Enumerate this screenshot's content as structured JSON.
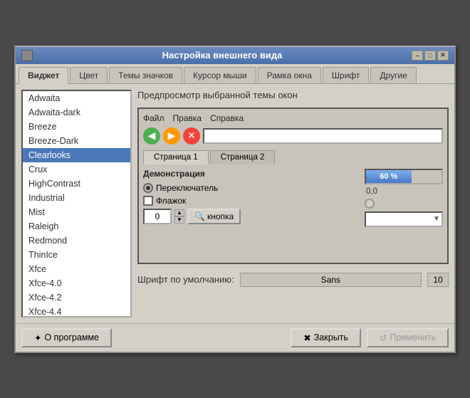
{
  "window": {
    "title": "Настройка внешнего вида",
    "icon": "settings-icon"
  },
  "titlebar": {
    "controls": {
      "minimize": "–",
      "maximize": "□",
      "close": "✕"
    }
  },
  "tabs": {
    "items": [
      {
        "label": "Виджет",
        "active": true
      },
      {
        "label": "Цвет",
        "active": false
      },
      {
        "label": "Темы значков",
        "active": false
      },
      {
        "label": "Курсор мыши",
        "active": false
      },
      {
        "label": "Рамка окна",
        "active": false
      },
      {
        "label": "Шрифт",
        "active": false
      },
      {
        "label": "Другие",
        "active": false
      }
    ]
  },
  "theme_list": {
    "items": [
      "Adwaita",
      "Adwaita-dark",
      "Breeze",
      "Breeze-Dark",
      "Clearlooks",
      "Crux",
      "HighContrast",
      "Industrial",
      "Mist",
      "Raleigh",
      "Redmond",
      "ThinIce",
      "Xfce",
      "Xfce-4.0",
      "Xfce-4.2",
      "Xfce-4.4"
    ],
    "selected": "Clearlooks"
  },
  "preview": {
    "section_label": "Предпросмотр выбранной темы окон",
    "menubar": {
      "items": [
        "Файл",
        "Правка",
        "Справка"
      ]
    },
    "toolbar": {
      "back": "◀",
      "forward": "▶",
      "stop": "✕"
    },
    "tabs": {
      "items": [
        {
          "label": "Страница 1",
          "active": true
        },
        {
          "label": "Страница 2",
          "active": false
        }
      ]
    },
    "demo": {
      "title": "Демонстрация",
      "radio_label": "Переключатель",
      "checkbox_label": "Флажок",
      "spinner_value": "0",
      "button_label": "кнопка",
      "progress_value": 60,
      "progress_label": "60 %",
      "coord_label": "0,0",
      "dropdown_value": ""
    }
  },
  "font": {
    "label": "Шрифт по умолчанию:",
    "value": "Sans",
    "size": "10"
  },
  "buttons": {
    "about": "О программе",
    "close": "Закрыть",
    "apply": "Применить"
  }
}
